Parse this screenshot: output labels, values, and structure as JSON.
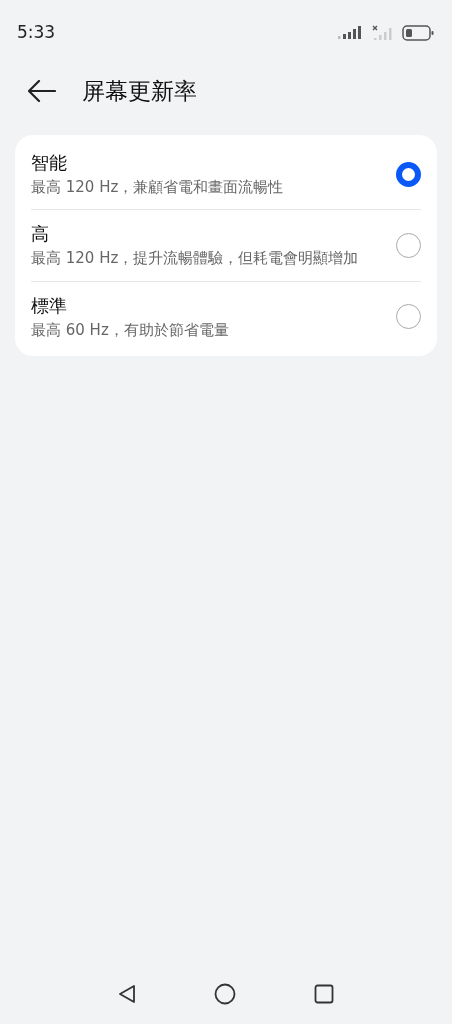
{
  "status_bar": {
    "time": "5:33"
  },
  "header": {
    "title": "屏幕更新率"
  },
  "options": [
    {
      "title": "智能",
      "description": "最高 120 Hz，兼顧省電和畫面流暢性",
      "selected": true
    },
    {
      "title": "高",
      "description": "最高 120 Hz，提升流暢體驗，但耗電會明顯增加",
      "selected": false
    },
    {
      "title": "標準",
      "description": "最高 60 Hz，有助於節省電量",
      "selected": false
    }
  ]
}
